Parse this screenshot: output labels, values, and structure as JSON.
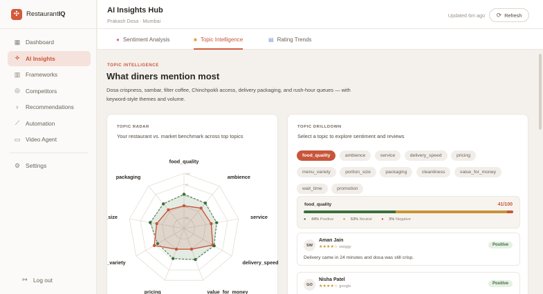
{
  "brand": {
    "logo_glyph": "✣",
    "name_pre": "Restaurant",
    "name_bold": "IQ"
  },
  "sidebar": {
    "items": [
      {
        "icon": "dashboard-icon",
        "glyph": "▦",
        "label": "Dashboard"
      },
      {
        "icon": "sparkle-icon",
        "glyph": "✧",
        "label": "AI Insights",
        "active": true
      },
      {
        "icon": "bar-chart-icon",
        "glyph": "▥",
        "label": "Frameworks"
      },
      {
        "icon": "target-icon",
        "glyph": "◎",
        "label": "Competitors"
      },
      {
        "icon": "lightbulb-icon",
        "glyph": "♁",
        "label": "Recommendations"
      },
      {
        "icon": "wand-icon",
        "glyph": "⟋",
        "label": "Automation"
      },
      {
        "icon": "video-icon",
        "glyph": "▭",
        "label": "Video Agent"
      }
    ],
    "settings": {
      "icon": "gear-icon",
      "glyph": "⚙",
      "label": "Settings"
    },
    "logout": {
      "icon": "logout-icon",
      "glyph": "↦",
      "label": "Log out"
    }
  },
  "header": {
    "title": "AI Insights Hub",
    "subtitle": "Prakash Dosa · Mumbai",
    "updated": "Updated 6m ago",
    "refresh_label": "Refresh"
  },
  "tabs": [
    {
      "icon": "brain-icon",
      "glyph": "●",
      "color": "#d96a9a",
      "label": "Sentiment Analysis"
    },
    {
      "icon": "folder-icon",
      "glyph": "■",
      "color": "#e0a43a",
      "label": "Topic Intelligence",
      "active": true
    },
    {
      "icon": "chart-icon",
      "glyph": "▤",
      "color": "#7b8fd0",
      "label": "Rating Trends"
    }
  ],
  "page": {
    "eyebrow": "TOPIC INTELLIGENCE",
    "heading": "What diners mention most",
    "description": "Dosa crispness, sambar, filter coffee, Chinchpokli access, delivery packaging, and rush-hour queues — with keyword-style themes and volume."
  },
  "radar_card": {
    "eyebrow": "TOPIC RADAR",
    "subtitle": "Your restaurant vs. market benchmark across top topics"
  },
  "chart_data": {
    "type": "radar",
    "axes": [
      "food_quality",
      "ambience",
      "service",
      "delivery_speed",
      "value_for_money",
      "pricing",
      "menu_variety",
      "portion_size",
      "packaging"
    ],
    "tick_labels": [
      "100",
      "80",
      "60",
      "40",
      "20"
    ],
    "ylim": [
      0,
      100
    ],
    "series": [
      {
        "color": "#c8553a",
        "values": [
          41,
          48,
          50,
          60,
          40,
          40,
          62,
          50,
          44
        ]
      },
      {
        "color": "#3a6f3c",
        "dashed": true,
        "values": [
          62,
          60,
          60,
          63,
          60,
          58,
          55,
          62,
          58
        ]
      }
    ]
  },
  "drilldown": {
    "eyebrow": "TOPIC DRILLDOWN",
    "subtitle": "Select a topic to explore sentiment and reviews",
    "chips": [
      "food_quality",
      "ambience",
      "service",
      "delivery_speed",
      "pricing",
      "menu_variety",
      "portion_size",
      "packaging",
      "cleanliness",
      "value_for_money",
      "wait_time",
      "promotion"
    ],
    "selected": {
      "topic": "food_quality",
      "score": "41/100",
      "positive_pct": 44,
      "neutral_pct": 53,
      "negative_pct": 3,
      "positive_label": "44%",
      "positive_word": "Positive",
      "neutral_label": "53%",
      "neutral_word": "Neutral",
      "negative_label": "3%",
      "negative_word": "Negative"
    },
    "reviews": [
      {
        "initials": "SW",
        "name": "Aman Jain",
        "stars": "★★★★☆",
        "source": "swiggy",
        "sentiment": "Positive",
        "text": "Delivery came in 24 minutes and dosa was still crisp."
      },
      {
        "initials": "GO",
        "name": "Nisha Patel",
        "stars": "★★★★☆",
        "source": "google",
        "sentiment": "Positive",
        "text": ""
      }
    ]
  }
}
